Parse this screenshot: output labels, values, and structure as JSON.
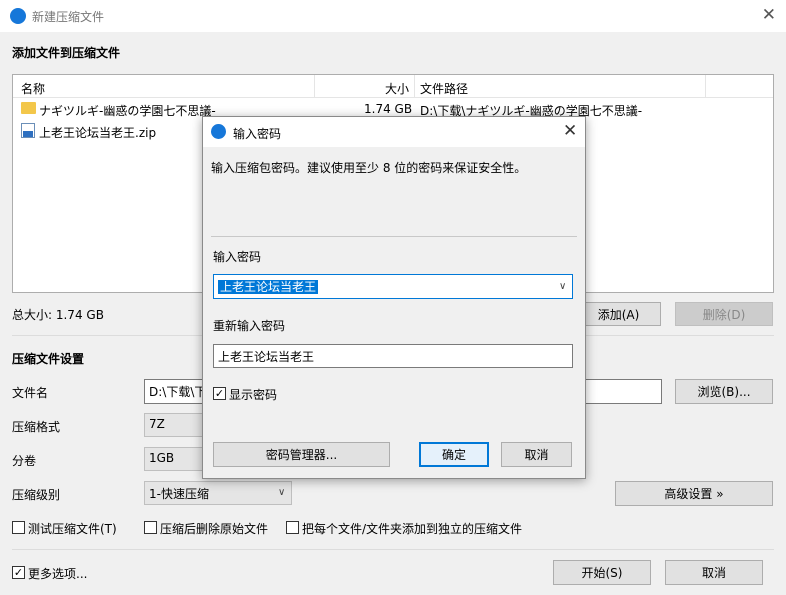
{
  "window": {
    "title": "新建压缩文件"
  },
  "section_add": "添加文件到压缩文件",
  "file_list": {
    "columns": [
      "名称",
      "大小",
      "文件路径"
    ],
    "rows": [
      {
        "name": "ナギツルギ-幽惑の学園七不思議-",
        "size": "1.74 GB",
        "path": "D:\\下载\\ナギツルギ-幽惑の学園七不思議-",
        "icon": "folder-icon"
      },
      {
        "name": "上老王论坛当老王.zip",
        "size": "",
        "path": "",
        "icon": "zip-file-icon"
      }
    ]
  },
  "total_size": "总大小: 1.74 GB",
  "buttons": {
    "add": "添加(A)",
    "delete": "删除(D)",
    "browse": "浏览(B)...",
    "advanced": "高级设置 »",
    "start": "开始(S)",
    "cancel": "取消"
  },
  "settings": {
    "title": "压缩文件设置",
    "filename_label": "文件名",
    "filename_value": "D:\\下载\\下",
    "format_label": "压缩格式",
    "format_value": "7Z",
    "volume_label": "分卷",
    "volume_value": "1GB",
    "level_label": "压缩级别",
    "level_value": "1-快速压缩"
  },
  "options": {
    "test": "测试压缩文件(T)",
    "delete_after": "压缩后删除原始文件",
    "each_separate": "把每个文件/文件夹添加到独立的压缩文件",
    "more": "更多选项..."
  },
  "dialog": {
    "title": "输入密码",
    "hint": "输入压缩包密码。建议使用至少 8 位的密码来保证安全性。",
    "password_label": "输入密码",
    "password_value": "上老王论坛当老王",
    "repeat_label": "重新输入密码",
    "repeat_value": "上老王论坛当老王",
    "show_password": "显示密码",
    "manager_button": "密码管理器...",
    "ok_button": "确定",
    "cancel_button": "取消"
  },
  "colors": {
    "accent": "#0078d7",
    "app_icon": "#1677d9",
    "folder": "#f3c74a"
  }
}
